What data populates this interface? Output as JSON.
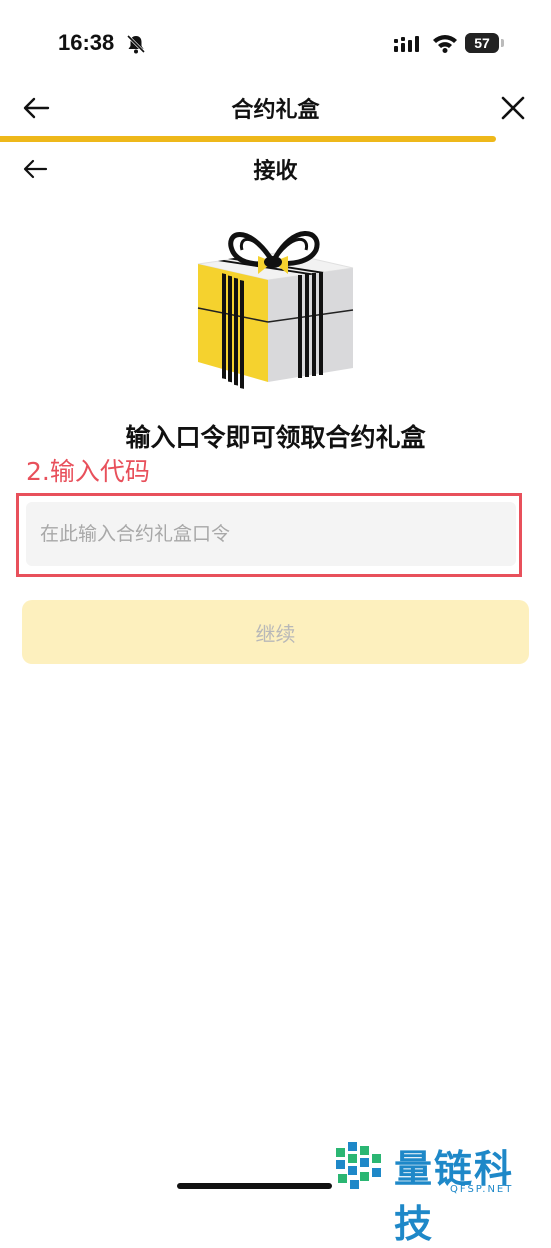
{
  "status_bar": {
    "time": "16:38",
    "battery": "57",
    "battery_level": 0.57
  },
  "header": {
    "title": "合约礼盒",
    "back_icon": "arrow-left-icon",
    "close_icon": "close-icon",
    "progress": 0.9,
    "progress_color": "#EEB81A"
  },
  "subheader": {
    "title": "接收",
    "back_icon": "arrow-left-icon"
  },
  "main": {
    "gift_icon": "gift-box-icon",
    "headline": "输入口令即可领取合约礼盒",
    "annotation": "2.输入代码",
    "code_input": {
      "placeholder": "在此输入合约礼盒口令",
      "value": ""
    },
    "continue_label": "继续"
  },
  "watermark": {
    "text": "量链科技",
    "sub": "QFSP.NET",
    "color": "#1E88C8"
  },
  "colors": {
    "accent": "#EEB81A",
    "annotation": "#E8505B",
    "button_disabled_bg": "#FDF0BE"
  }
}
